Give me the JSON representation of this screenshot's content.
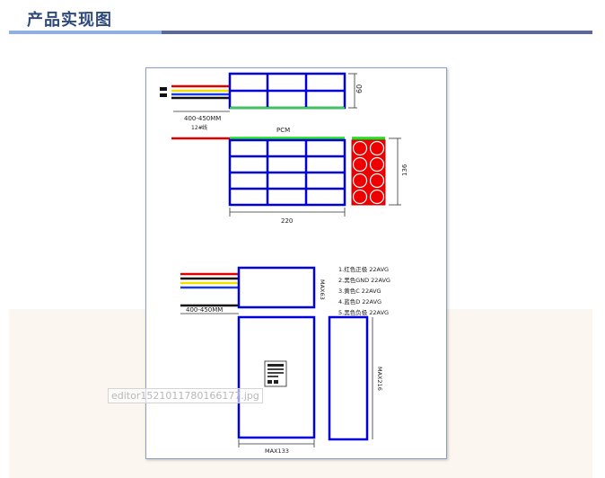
{
  "header": {
    "title": "产品实现图"
  },
  "drawing": {
    "dim_length_top": "400-450MM",
    "wire_gauge_note": "12#",
    "wire_note_suffix": "线",
    "pcm_label": "PCM",
    "dim_height_1": "60",
    "dim_width": "220",
    "dim_height_2": "136",
    "bottom_length": "400-450MM",
    "max_height_1": "MAX63",
    "max_width": "MAX133",
    "max_height_2": "MAX216",
    "wire_specs": [
      "1.红色正极 22AVG",
      "2.黑色GND 22AVG",
      "3.黄色C 22AVG",
      "4.蓝色D 22AVG",
      "5.黑色负极 22AVG"
    ]
  },
  "image": {
    "filename": "editor1521011780166177.jpg"
  },
  "colors": {
    "cell_stroke": "#0000dd",
    "pcm_green": "#22dd22",
    "cell_red": "#ee0000",
    "title_blue": "#2f4a7a"
  }
}
